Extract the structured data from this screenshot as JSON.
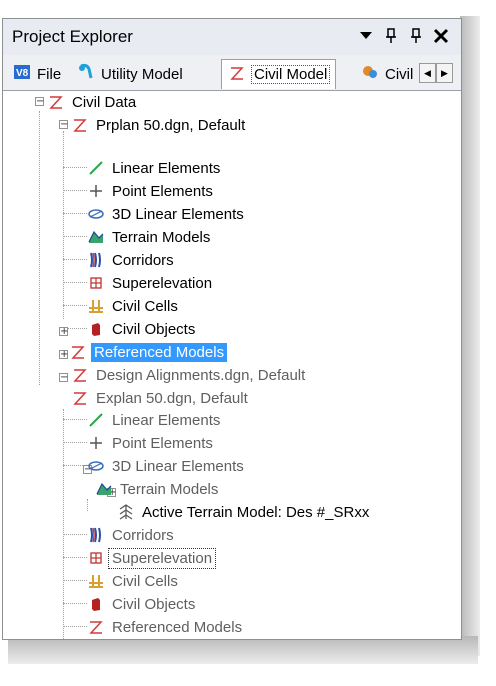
{
  "window": {
    "title": "Project Explorer"
  },
  "titlebar_icons": [
    "dropdown-icon",
    "pin-icon",
    "pin-icon",
    "close-icon"
  ],
  "tabs": [
    {
      "label": "File",
      "icon": "file-icon"
    },
    {
      "label": "Utility Model",
      "icon": "utility-model-icon"
    },
    {
      "label": "Civil Model",
      "icon": "civil-model-icon",
      "active": true
    },
    {
      "label": "Civil",
      "icon": "civil-icon"
    }
  ],
  "tree": {
    "root": "Civil Data",
    "prplan": {
      "label": "Prplan 50.dgn, Default",
      "children": [
        "Linear Elements",
        "Point Elements",
        "3D Linear Elements",
        "Terrain Models",
        "Corridors",
        "Superelevation",
        "Civil Cells",
        "Civil Objects",
        "Referenced Models"
      ]
    },
    "design": {
      "label": "Design Alignments.dgn, Default"
    },
    "explan": {
      "label": "Explan 50.dgn, Default",
      "children": [
        "Linear Elements",
        "Point Elements",
        "3D Linear Elements",
        "Terrain Models",
        "Corridors",
        "Superelevation",
        "Civil Cells",
        "Civil Objects",
        "Referenced Models"
      ],
      "terrain_child": "Active Terrain Model: Des #_SRxx"
    }
  },
  "colors": {
    "selection": "#3399ff",
    "civil_red": "#d43a3a"
  }
}
